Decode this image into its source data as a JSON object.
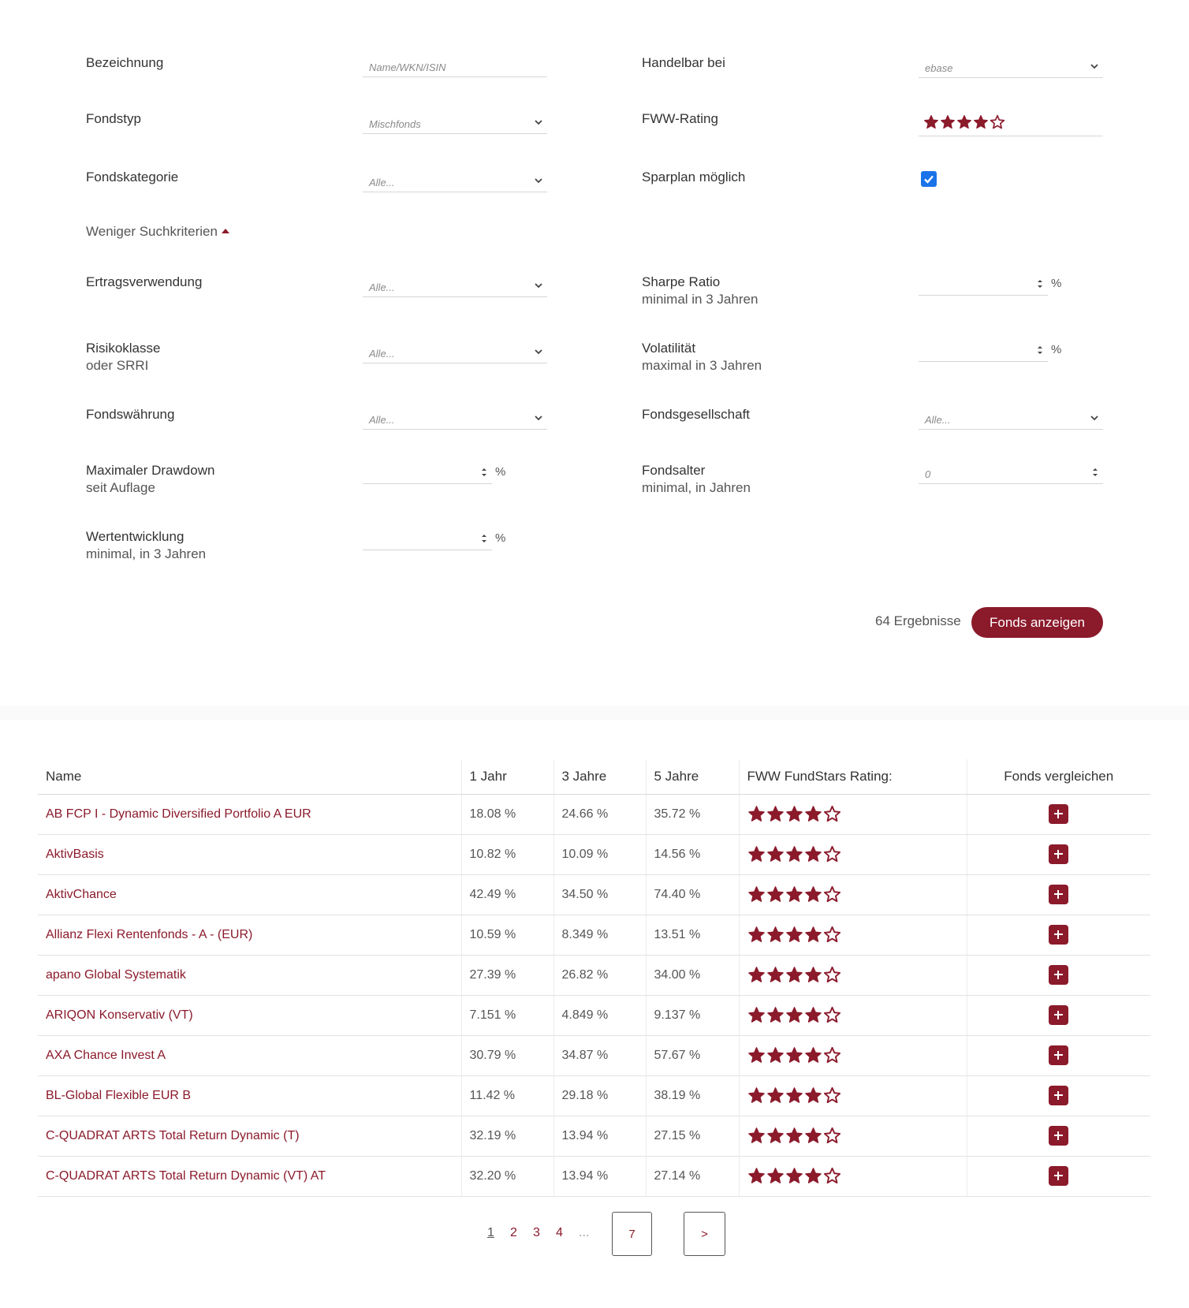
{
  "filters": {
    "bezeichnung": {
      "label": "Bezeichnung",
      "placeholder": "Name/WKN/ISIN"
    },
    "handelbar": {
      "label": "Handelbar bei",
      "value": "ebase"
    },
    "fondstyp": {
      "label": "Fondstyp",
      "value": "Mischfonds"
    },
    "fww_rating": {
      "label": "FWW-Rating",
      "stars_filled": 4,
      "stars_total": 5
    },
    "fondskategorie": {
      "label": "Fondskategorie",
      "value": "Alle..."
    },
    "sparplan": {
      "label": "Sparplan möglich",
      "checked": true
    },
    "toggle_label": "Weniger Suchkriterien",
    "ertragsverwendung": {
      "label": "Ertragsverwendung",
      "value": "Alle..."
    },
    "sharpe": {
      "label": "Sharpe Ratio",
      "sub": "minimal in 3 Jahren",
      "unit": "%"
    },
    "risikoklasse": {
      "label": "Risikoklasse",
      "sub": "oder SRRI",
      "value": "Alle..."
    },
    "volatilitaet": {
      "label": "Volatilität",
      "sub": "maximal in 3 Jahren",
      "unit": "%"
    },
    "fondswaehrung": {
      "label": "Fondswährung",
      "value": "Alle..."
    },
    "fondsgesellschaft": {
      "label": "Fondsgesellschaft",
      "value": "Alle..."
    },
    "drawdown": {
      "label": "Maximaler Drawdown",
      "sub": "seit Auflage",
      "unit": "%"
    },
    "fondsalter": {
      "label": "Fondsalter",
      "sub": "minimal, in Jahren",
      "value": "0"
    },
    "wertentwicklung": {
      "label": "Wertentwicklung",
      "sub": "minimal, in 3 Jahren",
      "unit": "%"
    }
  },
  "results": {
    "count_text": "64 Ergebnisse",
    "button": "Fonds anzeigen"
  },
  "table": {
    "headers": [
      "Name",
      "1 Jahr",
      "3 Jahre",
      "5 Jahre",
      "FWW FundStars Rating:",
      "Fonds vergleichen"
    ],
    "rows": [
      {
        "name": "AB FCP I - Dynamic Diversified Portfolio A EUR",
        "y1": "18.08 %",
        "y3": "24.66 %",
        "y5": "35.72 %",
        "stars": 4
      },
      {
        "name": "AktivBasis",
        "y1": "10.82 %",
        "y3": "10.09 %",
        "y5": "14.56 %",
        "stars": 4
      },
      {
        "name": "AktivChance",
        "y1": "42.49 %",
        "y3": "34.50 %",
        "y5": "74.40 %",
        "stars": 4
      },
      {
        "name": "Allianz Flexi Rentenfonds - A - (EUR)",
        "y1": "10.59 %",
        "y3": "8.349 %",
        "y5": "13.51 %",
        "stars": 4
      },
      {
        "name": "apano Global Systematik",
        "y1": "27.39 %",
        "y3": "26.82 %",
        "y5": "34.00 %",
        "stars": 4
      },
      {
        "name": "ARIQON Konservativ (VT)",
        "y1": "7.151 %",
        "y3": "4.849 %",
        "y5": "9.137 %",
        "stars": 4
      },
      {
        "name": "AXA Chance Invest A",
        "y1": "30.79 %",
        "y3": "34.87 %",
        "y5": "57.67 %",
        "stars": 4
      },
      {
        "name": "BL-Global Flexible EUR B",
        "y1": "11.42 %",
        "y3": "29.18 %",
        "y5": "38.19 %",
        "stars": 4
      },
      {
        "name": "C-QUADRAT ARTS Total Return Dynamic (T)",
        "y1": "32.19 %",
        "y3": "13.94 %",
        "y5": "27.15 %",
        "stars": 4
      },
      {
        "name": "C-QUADRAT ARTS Total Return Dynamic (VT) AT",
        "y1": "32.20 %",
        "y3": "13.94 %",
        "y5": "27.14 %",
        "stars": 4
      }
    ]
  },
  "pagination": {
    "pages": [
      "1",
      "2",
      "3",
      "4"
    ],
    "current": "1",
    "ellipsis": "...",
    "last": "7",
    "next": ">"
  },
  "colors": {
    "brand": "#8b1a2b",
    "checkbox": "#1a73e8"
  },
  "icons": {
    "star": "star-icon",
    "select": "chevron-down-icon",
    "spinner": "spinner-icon",
    "compare": "plus-icon"
  }
}
